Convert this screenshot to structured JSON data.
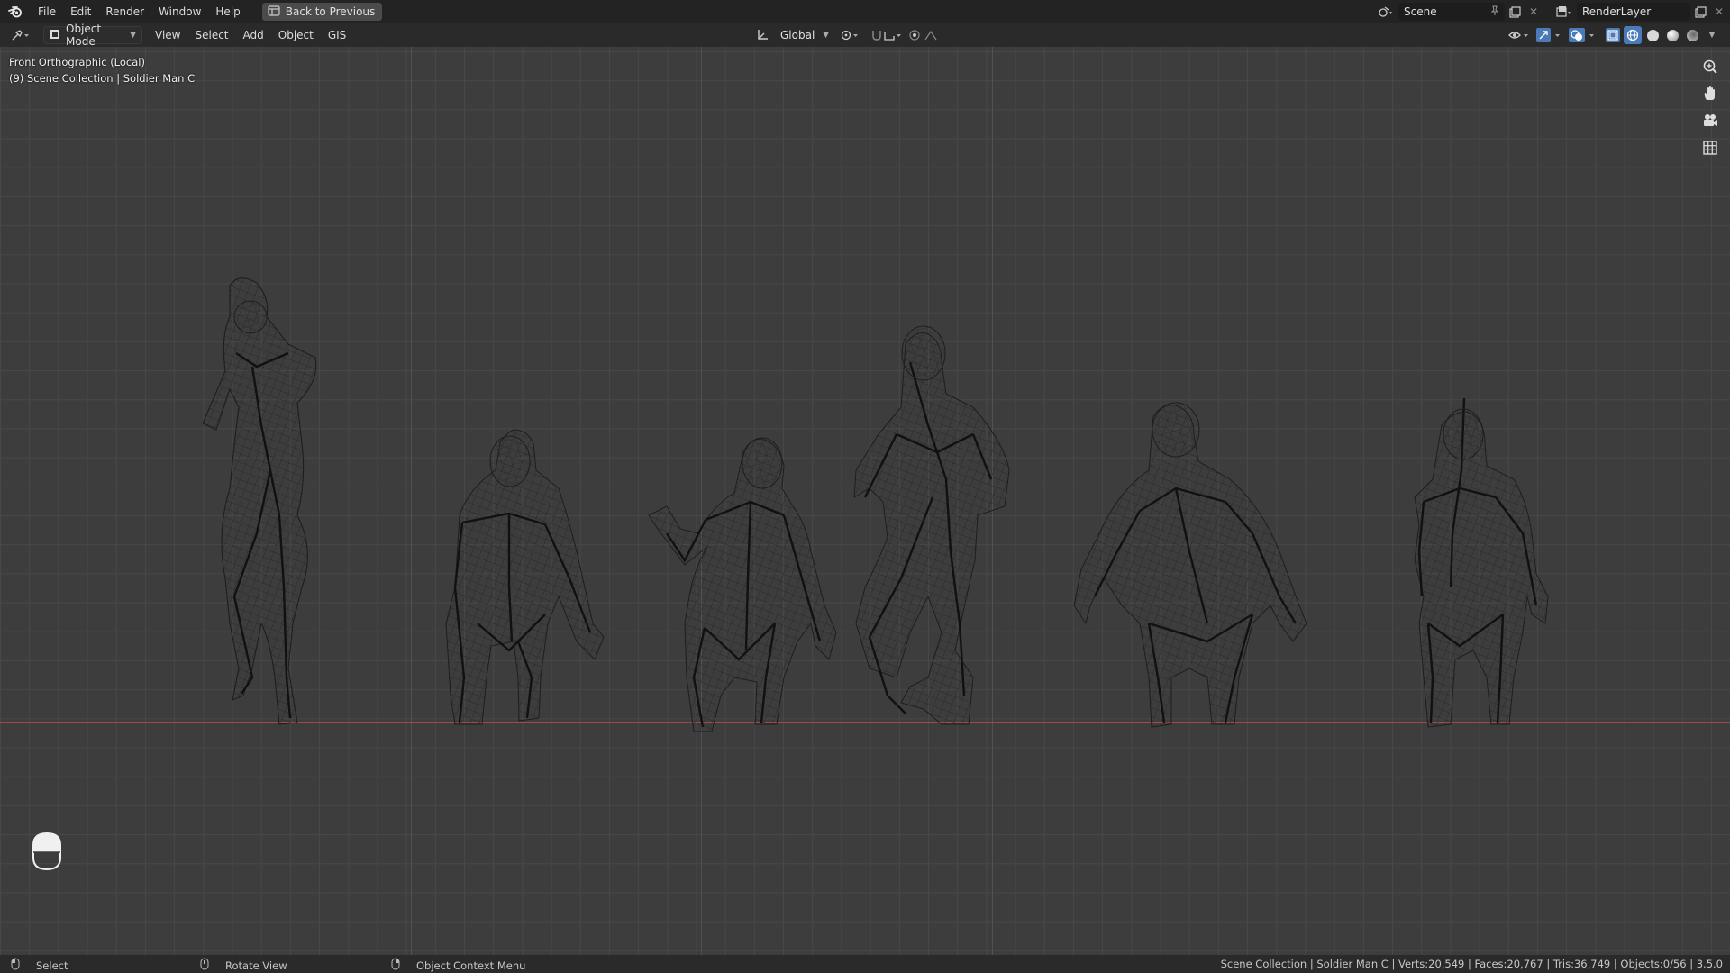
{
  "menu": {
    "file": "File",
    "edit": "Edit",
    "render": "Render",
    "window": "Window",
    "help": "Help",
    "back_button": "Back to Previous"
  },
  "scene": {
    "label": "Scene"
  },
  "render_layer": {
    "label": "RenderLayer"
  },
  "viewport_header": {
    "mode": "Object Mode",
    "view": "View",
    "select": "Select",
    "add": "Add",
    "object": "Object",
    "gis": "GIS",
    "orientation": "Global"
  },
  "viewport": {
    "view_name": "Front Orthographic (Local)",
    "collection_info": "(9) Scene Collection | Soldier Man C"
  },
  "statusbar": {
    "select": "Select",
    "rotate": "Rotate View",
    "context_menu": "Object Context Menu",
    "stats": "Scene Collection | Soldier Man C | Verts:20,549 | Faces:20,767 | Tris:36,749 | Objects:0/56 | 3.5.0"
  },
  "colors": {
    "topbar_bg": "#232323",
    "header_bg": "#2a2a2a",
    "viewport_bg": "#3d3d3d",
    "grid_line": "#484848",
    "x_axis": "#a9454f",
    "active_shading": "#4a7ab8"
  },
  "icons": [
    "blender-logo-icon",
    "back-to-previous-icon",
    "scene-icon",
    "pin-icon",
    "new-scene-icon",
    "close-icon",
    "render-layer-icon",
    "editor-type-icon",
    "object-mode-icon",
    "transform-orientation-icon",
    "pivot-icon",
    "snap-icon",
    "proportional-edit-icon",
    "visibility-icon",
    "gizmo-icon",
    "overlay-icon",
    "xray-icon",
    "wireframe-shading-icon",
    "solid-shading-icon",
    "material-shading-icon",
    "rendered-shading-icon",
    "zoom-icon",
    "pan-hand-icon",
    "camera-icon",
    "grid-view-icon",
    "mouse-icon"
  ]
}
